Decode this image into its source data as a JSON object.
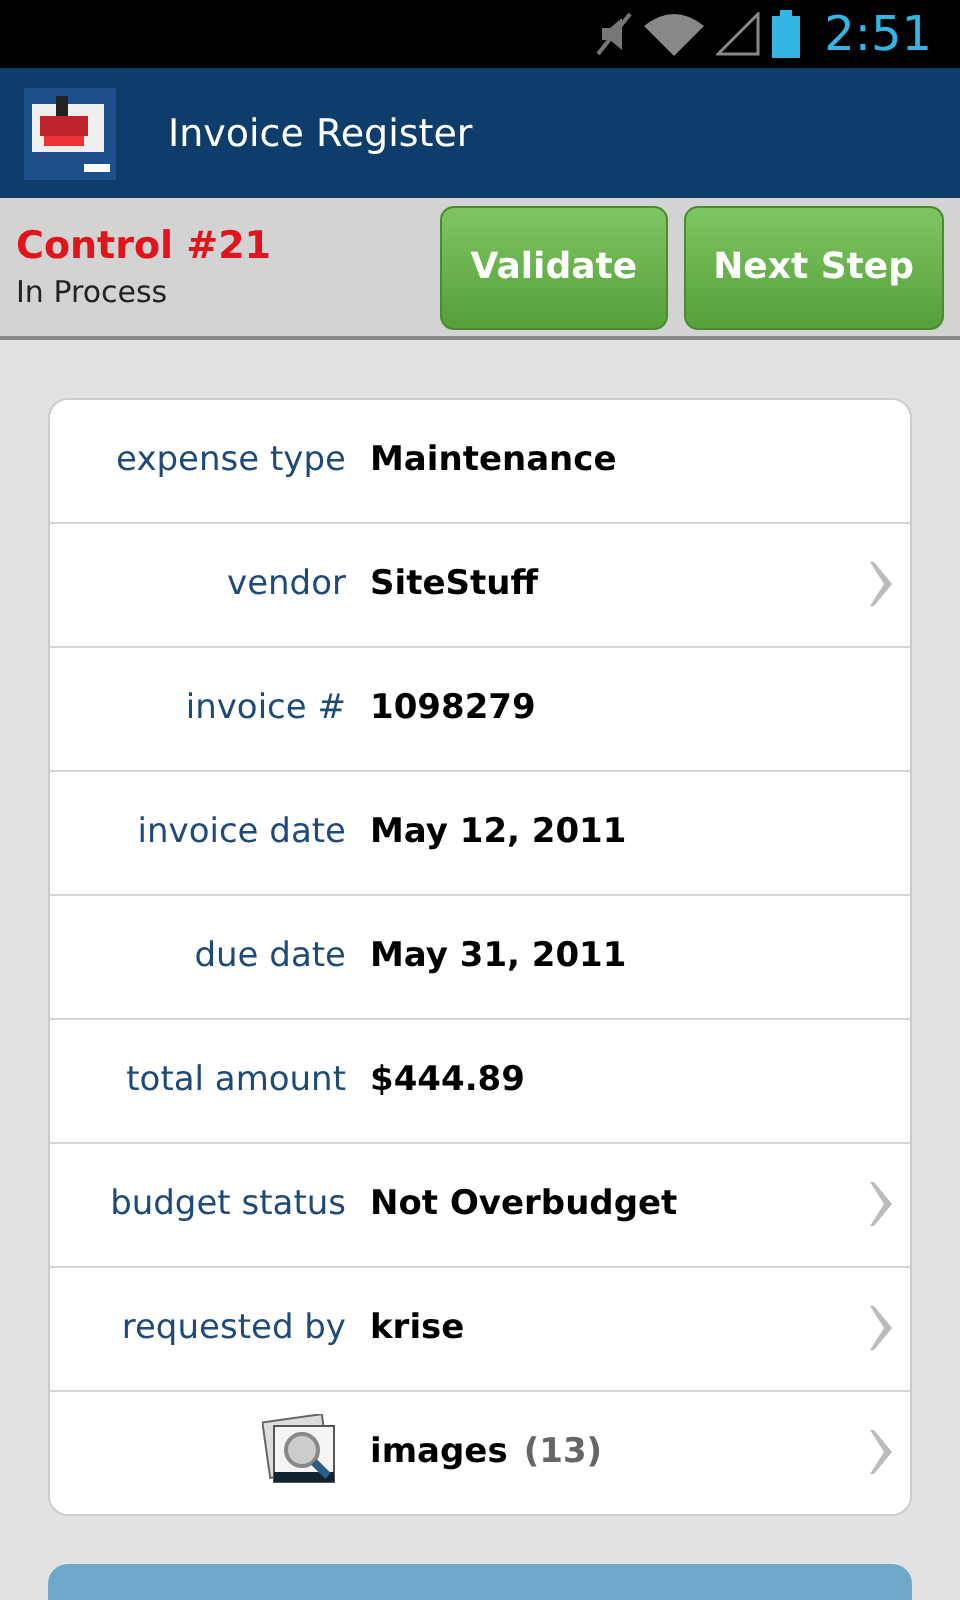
{
  "status_bar": {
    "time": "2:51"
  },
  "app_bar": {
    "title": "Invoice Register"
  },
  "header": {
    "control": "Control #21",
    "status": "In Process",
    "buttons": [
      "Validate",
      "Next Step"
    ]
  },
  "fields": [
    {
      "kind": "field",
      "label": "expense type",
      "value": "Maintenance",
      "chevron": false
    },
    {
      "kind": "field",
      "label": "vendor",
      "value": "SiteStuff",
      "chevron": true
    },
    {
      "kind": "field",
      "label": "invoice #",
      "value": "1098279",
      "chevron": false
    },
    {
      "kind": "field",
      "label": "invoice date",
      "value": "May 12, 2011",
      "chevron": false
    },
    {
      "kind": "field",
      "label": "due date",
      "value": "May 31, 2011",
      "chevron": false
    },
    {
      "kind": "field",
      "label": "total amount",
      "value": "$444.89",
      "chevron": false
    },
    {
      "kind": "field",
      "label": "budget status",
      "value": "Not Overbudget",
      "chevron": true
    },
    {
      "kind": "field",
      "label": "requested by",
      "value": "krise",
      "chevron": true
    },
    {
      "kind": "images",
      "value": "images",
      "count": "(13)",
      "chevron": true
    }
  ]
}
